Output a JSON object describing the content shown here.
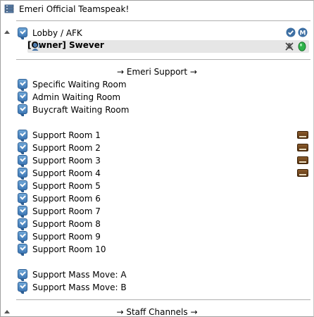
{
  "window": {
    "title": "Emeri Official Teamspeak!",
    "server_icon": "server-icon"
  },
  "lobby": {
    "channel_name": "Lobby / AFK",
    "icons": [
      "check-circle-icon",
      "moderated-m-icon"
    ],
    "user": {
      "name": "[Owner] Swever",
      "status_icon": "user-talk-icon",
      "icons": [
        "muted-mic-icon",
        "green-gem-icon"
      ]
    }
  },
  "spacers": {
    "support": "→ Emeri Support →",
    "staff": "→ Staff Channels →"
  },
  "waiting_rooms": [
    "Specific Waiting Room",
    "Admin Waiting Room",
    "Buycraft Waiting Room"
  ],
  "support_rooms": [
    {
      "name": "Support Room 1",
      "has_book": true
    },
    {
      "name": "Support Room 2",
      "has_book": true
    },
    {
      "name": "Support Room 3",
      "has_book": true
    },
    {
      "name": "Support Room 4",
      "has_book": true
    },
    {
      "name": "Support Room 5",
      "has_book": false
    },
    {
      "name": "Support Room 6",
      "has_book": false
    },
    {
      "name": "Support Room 7",
      "has_book": false
    },
    {
      "name": "Support Room 8",
      "has_book": false
    },
    {
      "name": "Support Room 9",
      "has_book": false
    },
    {
      "name": "Support Room 10",
      "has_book": false
    }
  ],
  "mass_move": [
    "Support Mass Move:  A",
    "Support Mass Move:  B"
  ],
  "colors": {
    "channel_icon": "#3f79b6",
    "selected_row": "#e6e6e6",
    "gem": "#2fb34a"
  }
}
